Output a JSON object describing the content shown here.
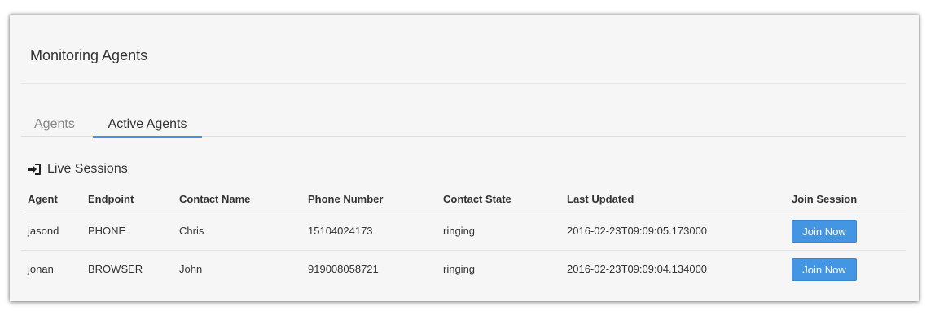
{
  "header": {
    "title": "Monitoring Agents"
  },
  "tabs": [
    {
      "label": "Agents"
    },
    {
      "label": "Active Agents"
    }
  ],
  "section": {
    "title": "Live Sessions",
    "icon": "sign-in-icon"
  },
  "table": {
    "columns": [
      "Agent",
      "Endpoint",
      "Contact Name",
      "Phone Number",
      "Contact State",
      "Last Updated",
      "Join Session"
    ],
    "rows": [
      {
        "agent": "jasond",
        "endpoint": "PHONE",
        "contact_name": "Chris",
        "phone": "15104024173",
        "state": "ringing",
        "updated": "2016-02-23T09:09:05.173000",
        "action": "Join Now"
      },
      {
        "agent": "jonan",
        "endpoint": "BROWSER",
        "contact_name": "John",
        "phone": "919008058721",
        "state": "ringing",
        "updated": "2016-02-23T09:09:04.134000",
        "action": "Join Now"
      }
    ]
  },
  "colors": {
    "accent": "#4596e2",
    "background": "#f6f6f6"
  }
}
